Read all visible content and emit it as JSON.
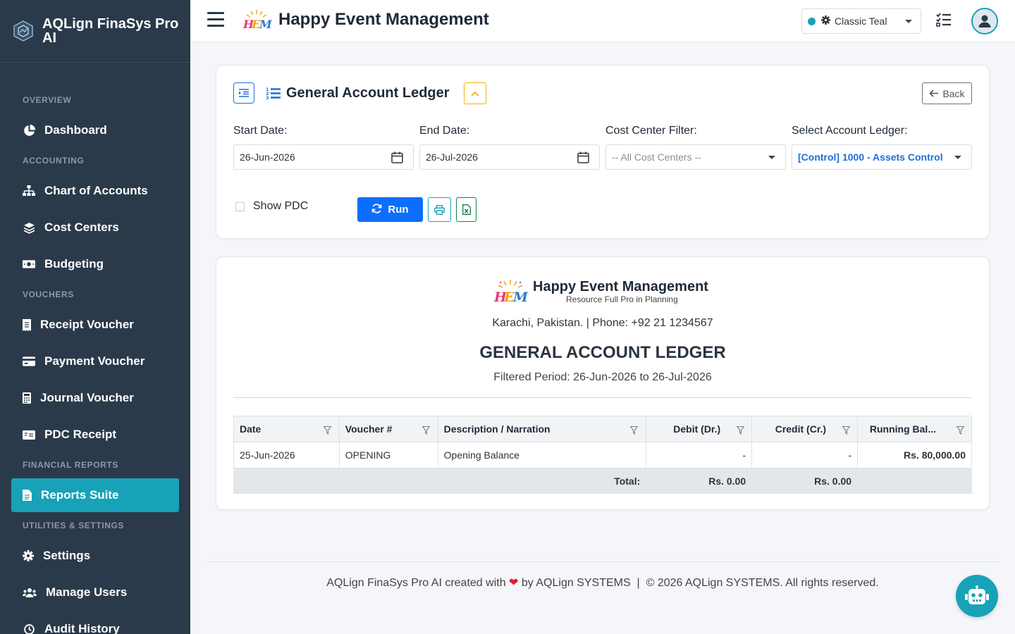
{
  "app": {
    "name": "AQLign FinaSys Pro AI"
  },
  "header": {
    "company_title": "Happy Event Management",
    "theme": "Classic Teal"
  },
  "sidebar": {
    "sections": [
      {
        "title": "OVERVIEW",
        "items": [
          {
            "label": "Dashboard",
            "icon": "pie-chart-icon"
          }
        ]
      },
      {
        "title": "ACCOUNTING",
        "items": [
          {
            "label": "Chart of Accounts",
            "icon": "sitemap-icon"
          },
          {
            "label": "Cost Centers",
            "icon": "layers-icon"
          },
          {
            "label": "Budgeting",
            "icon": "money-icon"
          }
        ]
      },
      {
        "title": "VOUCHERS",
        "items": [
          {
            "label": "Receipt Voucher",
            "icon": "receipt-icon"
          },
          {
            "label": "Payment Voucher",
            "icon": "credit-card-icon"
          },
          {
            "label": "Journal Voucher",
            "icon": "calculator-icon"
          },
          {
            "label": "PDC Receipt",
            "icon": "money-check-icon"
          }
        ]
      },
      {
        "title": "FINANCIAL REPORTS",
        "items": [
          {
            "label": "Reports Suite",
            "icon": "file-report-icon",
            "active": true
          }
        ]
      },
      {
        "title": "UTILITIES & SETTINGS",
        "items": [
          {
            "label": "Settings",
            "icon": "gear-icon"
          },
          {
            "label": "Manage Users",
            "icon": "users-icon"
          },
          {
            "label": "Audit History",
            "icon": "history-icon"
          }
        ]
      }
    ]
  },
  "filter_card": {
    "title": "General Account Ledger",
    "back_label": "Back",
    "start_date_label": "Start Date:",
    "start_date": "26-Jun-2026",
    "end_date_label": "End Date:",
    "end_date": "26-Jul-2026",
    "cost_center_label": "Cost Center Filter:",
    "cost_center_value": "-- All Cost Centers --",
    "account_label": "Select Account Ledger:",
    "account_value": "[Control] 1000 - Assets Control",
    "show_pdc_label": "Show PDC",
    "show_pdc_checked": false,
    "run_label": "Run"
  },
  "report": {
    "company": "Happy Event Management",
    "tagline": "Resource Full Pro in Planning",
    "address": "Karachi, Pakistan. | Phone: +92 21 1234567",
    "title": "GENERAL ACCOUNT LEDGER",
    "period": "Filtered Period: 26-Jun-2026 to 26-Jul-2026",
    "columns": [
      "Date",
      "Voucher #",
      "Description / Narration",
      "Debit (Dr.)",
      "Credit (Cr.)",
      "Running Bal..."
    ],
    "rows": [
      {
        "date": "25-Jun-2026",
        "voucher": "OPENING",
        "description": "Opening Balance",
        "debit": "-",
        "credit": "-",
        "balance": "Rs. 80,000.00"
      }
    ],
    "total_label": "Total:",
    "total_debit": "Rs. 0.00",
    "total_credit": "Rs. 0.00"
  },
  "footer": {
    "left": "AQLign FinaSys Pro AI created with",
    "heart": "❤",
    "by": "by AQLign SYSTEMS",
    "sep": "|",
    "right": "© 2026 AQLign SYSTEMS. All rights reserved."
  },
  "colors": {
    "sidebar_bg": "#2b3a4a",
    "accent": "#17a2b8",
    "primary": "#0d6efd",
    "positive": "#1a7f1a",
    "negative": "#a3161d"
  }
}
